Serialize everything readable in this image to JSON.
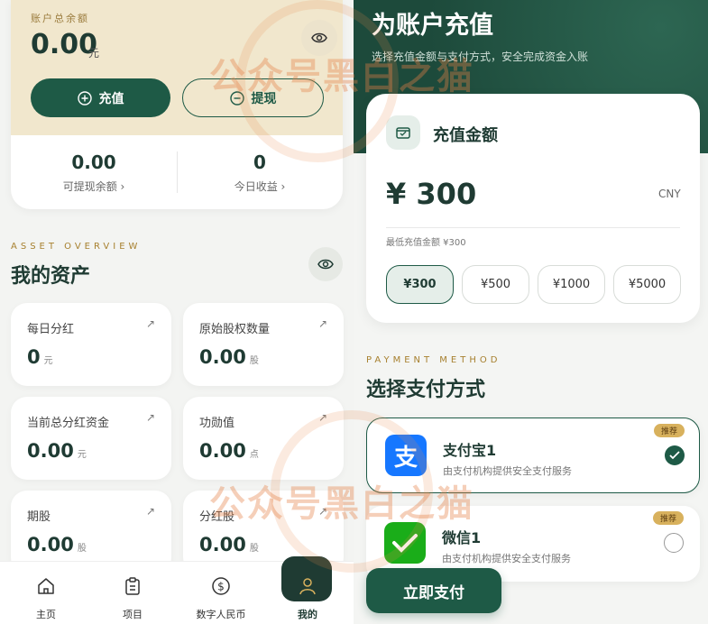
{
  "account": {
    "balance_label": "账户总余额",
    "balance_amount": "0.00",
    "balance_unit": "元",
    "recharge_label": "充值",
    "withdraw_label": "提现",
    "stats": [
      {
        "value": "0.00",
        "label": "可提现余额 ›"
      },
      {
        "value": "0",
        "label": "今日收益 ›"
      }
    ]
  },
  "overview": {
    "kicker": "ASSET OVERVIEW",
    "title": "我的资产",
    "items": [
      {
        "name": "每日分红",
        "value": "0",
        "unit": "元"
      },
      {
        "name": "原始股权数量",
        "value": "0.00",
        "unit": "股"
      },
      {
        "name": "当前总分红资金",
        "value": "0.00",
        "unit": "元"
      },
      {
        "name": "功勋值",
        "value": "0.00",
        "unit": "点"
      },
      {
        "name": "期股",
        "value": "0.00",
        "unit": "股"
      },
      {
        "name": "分红股",
        "value": "0.00",
        "unit": "股"
      }
    ],
    "arrow": "↗"
  },
  "tabbar": {
    "items": [
      {
        "label": "主页",
        "icon": "home-icon"
      },
      {
        "label": "项目",
        "icon": "clipboard-icon"
      },
      {
        "label": "数字人民币",
        "icon": "dollar-coin-icon"
      },
      {
        "label": "我的",
        "icon": "user-icon",
        "active": true
      }
    ]
  },
  "recharge": {
    "title": "为账户充值",
    "subtitle": "选择充值金额与支付方式，安全完成资金入账",
    "amount_title": "充值金额",
    "amount_value": "¥ 300",
    "currency": "CNY",
    "min_note": "最低充值金额 ¥300",
    "chips": [
      "¥300",
      "¥500",
      "¥1000",
      "¥5000"
    ],
    "selected_chip": "¥300"
  },
  "payment": {
    "kicker": "PAYMENT METHOD",
    "title": "选择支付方式",
    "methods": [
      {
        "name": "支付宝1",
        "desc": "由支付机构提供安全支付服务",
        "badge": "推荐",
        "selected": true,
        "color": "#1677ff",
        "logo": "支"
      },
      {
        "name": "微信1",
        "desc": "由支付机构提供安全支付服务",
        "badge": "推荐",
        "selected": false,
        "color": "#1aad19"
      }
    ],
    "pay_button": "立即支付"
  },
  "watermark": {
    "text": "公众号黑白之猫"
  },
  "colors": {
    "primary": "#1e5a46",
    "gold": "#a7802f",
    "cream": "#f1e7cd"
  }
}
